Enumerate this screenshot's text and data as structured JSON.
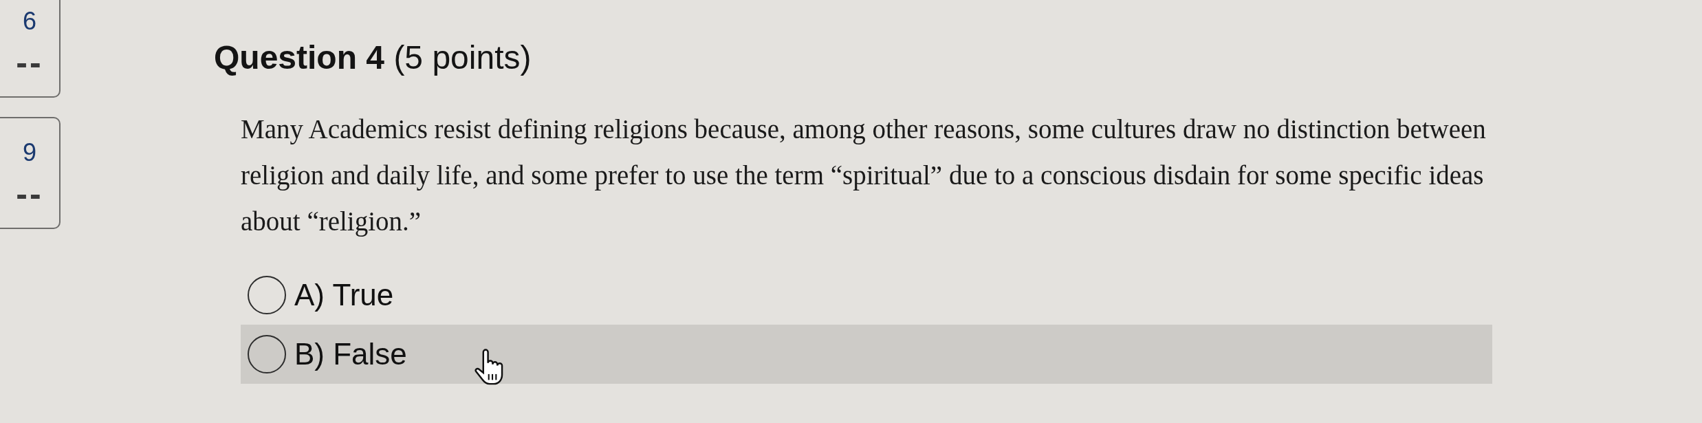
{
  "sidebar": {
    "items": [
      {
        "number": "6",
        "status": "--"
      },
      {
        "number": "9",
        "status": "--"
      }
    ]
  },
  "question": {
    "title": "**Question 4** (5 points)",
    "text": "Many Academics resist defining religions because, among other reasons, some cultures draw no distinction between religion and daily life, and some prefer to use the term “spiritual” due to a conscious disdain for some specific ideas about “religion.”",
    "options": [
      {
        "label": "A) True",
        "selected": false,
        "highlighted": false
      },
      {
        "label": "B) False",
        "selected": false,
        "highlighted": true
      }
    ]
  }
}
